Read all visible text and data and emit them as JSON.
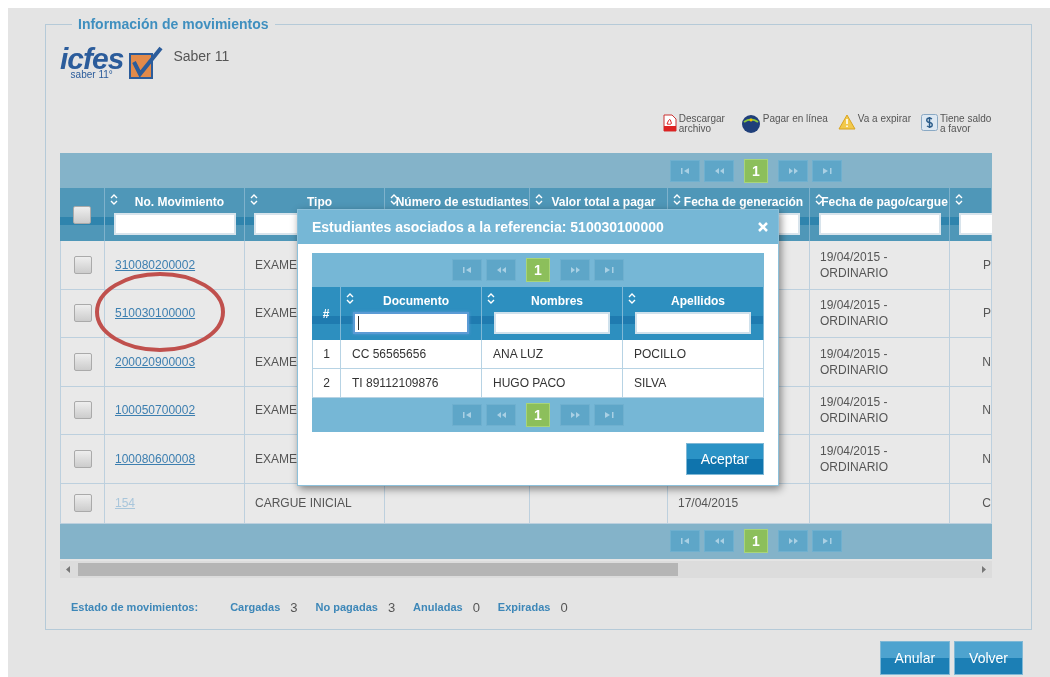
{
  "panel_title": "Información de movimientos",
  "logo": {
    "wordmark": "icfes",
    "tagline": "saber 11°",
    "product": "Saber 11"
  },
  "legend": [
    {
      "kind": "pdf",
      "label": "Descargar archivo"
    },
    {
      "kind": "pse",
      "label": "Pagar en línea"
    },
    {
      "kind": "warning",
      "label": "Va a expirar"
    },
    {
      "kind": "balance",
      "label": "Tiene saldo a favor"
    }
  ],
  "table": {
    "pager_top": {
      "page": "1"
    },
    "header_checked": false,
    "columns": [
      {
        "label": "No. Movimiento",
        "filter": true
      },
      {
        "label": "Tipo",
        "filter": true
      },
      {
        "label": "Número de estudiantes",
        "filter": false
      },
      {
        "label": "Valor total a pagar",
        "filter": false
      },
      {
        "label": "Fecha de generación",
        "filter": true
      },
      {
        "label": "Fecha de pago/cargue",
        "filter": true
      },
      {
        "filter": true
      }
    ],
    "rows": [
      {
        "checked": false,
        "disabled": false,
        "movimiento": "310080200002",
        "tipo": "EXAME",
        "fecha_pago": "19/04/2015 - ORDINARIO",
        "column_7": "P"
      },
      {
        "checked": false,
        "disabled": false,
        "movimiento": "510030100000",
        "tipo": "EXAME",
        "fecha_pago": "19/04/2015 - ORDINARIO",
        "column_7": "P"
      },
      {
        "checked": false,
        "disabled": false,
        "movimiento": "200020900003",
        "tipo": "EXAME",
        "fecha_pago": "19/04/2015 - ORDINARIO",
        "column_7": "N"
      },
      {
        "checked": false,
        "disabled": false,
        "movimiento": "100050700002",
        "tipo": "EXAME",
        "fecha_pago": "19/04/2015 - ORDINARIO",
        "column_7": "N"
      },
      {
        "checked": false,
        "disabled": false,
        "movimiento": "100080600008",
        "tipo": "EXAME",
        "fecha_pago": "19/04/2015 - ORDINARIO",
        "column_7": "N"
      },
      {
        "checked": false,
        "disabled": true,
        "movimiento": "154",
        "tipo": "CARGUE INICIAL",
        "fecha_generacion": "17/04/2015",
        "column_7": "C"
      }
    ],
    "pager_bottom": {
      "page": "1"
    }
  },
  "status": {
    "label": "Estado de movimientos:",
    "items": [
      {
        "label": "Cargadas",
        "count": "3"
      },
      {
        "label": "No pagadas",
        "count": "3"
      },
      {
        "label": "Anuladas",
        "count": "0"
      },
      {
        "label": "Expiradas",
        "count": "0"
      }
    ]
  },
  "buttons": [
    "Anular",
    "Volver"
  ],
  "modal": {
    "title": "Estudiantes asociados a la referencia: 510030100000",
    "pager_top": {
      "page": "1"
    },
    "index_header": "#",
    "columns": [
      {
        "label": "Documento",
        "focused": true
      },
      {
        "label": "Nombres",
        "focused": false
      },
      {
        "label": "Apellidos",
        "focused": false
      }
    ],
    "rows": [
      {
        "index": "1",
        "cells": [
          "CC 56565656",
          "ANA LUZ",
          "POCILLO"
        ]
      },
      {
        "index": "2",
        "cells": [
          "TI 89112109876",
          "HUGO PACO",
          "SILVA"
        ]
      }
    ],
    "pager_bottom": {
      "page": "1"
    },
    "button": "Aceptar"
  }
}
